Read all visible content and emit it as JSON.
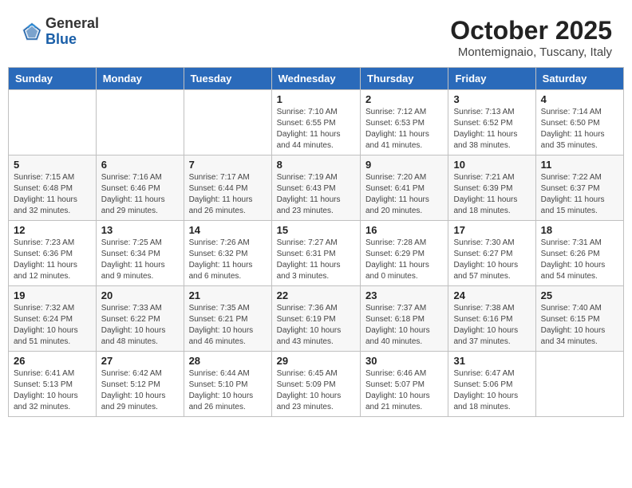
{
  "header": {
    "logo_general": "General",
    "logo_blue": "Blue",
    "month_title": "October 2025",
    "location": "Montemignaio, Tuscany, Italy"
  },
  "days_of_week": [
    "Sunday",
    "Monday",
    "Tuesday",
    "Wednesday",
    "Thursday",
    "Friday",
    "Saturday"
  ],
  "weeks": [
    [
      {
        "day": "",
        "info": ""
      },
      {
        "day": "",
        "info": ""
      },
      {
        "day": "",
        "info": ""
      },
      {
        "day": "1",
        "info": "Sunrise: 7:10 AM\nSunset: 6:55 PM\nDaylight: 11 hours and 44 minutes."
      },
      {
        "day": "2",
        "info": "Sunrise: 7:12 AM\nSunset: 6:53 PM\nDaylight: 11 hours and 41 minutes."
      },
      {
        "day": "3",
        "info": "Sunrise: 7:13 AM\nSunset: 6:52 PM\nDaylight: 11 hours and 38 minutes."
      },
      {
        "day": "4",
        "info": "Sunrise: 7:14 AM\nSunset: 6:50 PM\nDaylight: 11 hours and 35 minutes."
      }
    ],
    [
      {
        "day": "5",
        "info": "Sunrise: 7:15 AM\nSunset: 6:48 PM\nDaylight: 11 hours and 32 minutes."
      },
      {
        "day": "6",
        "info": "Sunrise: 7:16 AM\nSunset: 6:46 PM\nDaylight: 11 hours and 29 minutes."
      },
      {
        "day": "7",
        "info": "Sunrise: 7:17 AM\nSunset: 6:44 PM\nDaylight: 11 hours and 26 minutes."
      },
      {
        "day": "8",
        "info": "Sunrise: 7:19 AM\nSunset: 6:43 PM\nDaylight: 11 hours and 23 minutes."
      },
      {
        "day": "9",
        "info": "Sunrise: 7:20 AM\nSunset: 6:41 PM\nDaylight: 11 hours and 20 minutes."
      },
      {
        "day": "10",
        "info": "Sunrise: 7:21 AM\nSunset: 6:39 PM\nDaylight: 11 hours and 18 minutes."
      },
      {
        "day": "11",
        "info": "Sunrise: 7:22 AM\nSunset: 6:37 PM\nDaylight: 11 hours and 15 minutes."
      }
    ],
    [
      {
        "day": "12",
        "info": "Sunrise: 7:23 AM\nSunset: 6:36 PM\nDaylight: 11 hours and 12 minutes."
      },
      {
        "day": "13",
        "info": "Sunrise: 7:25 AM\nSunset: 6:34 PM\nDaylight: 11 hours and 9 minutes."
      },
      {
        "day": "14",
        "info": "Sunrise: 7:26 AM\nSunset: 6:32 PM\nDaylight: 11 hours and 6 minutes."
      },
      {
        "day": "15",
        "info": "Sunrise: 7:27 AM\nSunset: 6:31 PM\nDaylight: 11 hours and 3 minutes."
      },
      {
        "day": "16",
        "info": "Sunrise: 7:28 AM\nSunset: 6:29 PM\nDaylight: 11 hours and 0 minutes."
      },
      {
        "day": "17",
        "info": "Sunrise: 7:30 AM\nSunset: 6:27 PM\nDaylight: 10 hours and 57 minutes."
      },
      {
        "day": "18",
        "info": "Sunrise: 7:31 AM\nSunset: 6:26 PM\nDaylight: 10 hours and 54 minutes."
      }
    ],
    [
      {
        "day": "19",
        "info": "Sunrise: 7:32 AM\nSunset: 6:24 PM\nDaylight: 10 hours and 51 minutes."
      },
      {
        "day": "20",
        "info": "Sunrise: 7:33 AM\nSunset: 6:22 PM\nDaylight: 10 hours and 48 minutes."
      },
      {
        "day": "21",
        "info": "Sunrise: 7:35 AM\nSunset: 6:21 PM\nDaylight: 10 hours and 46 minutes."
      },
      {
        "day": "22",
        "info": "Sunrise: 7:36 AM\nSunset: 6:19 PM\nDaylight: 10 hours and 43 minutes."
      },
      {
        "day": "23",
        "info": "Sunrise: 7:37 AM\nSunset: 6:18 PM\nDaylight: 10 hours and 40 minutes."
      },
      {
        "day": "24",
        "info": "Sunrise: 7:38 AM\nSunset: 6:16 PM\nDaylight: 10 hours and 37 minutes."
      },
      {
        "day": "25",
        "info": "Sunrise: 7:40 AM\nSunset: 6:15 PM\nDaylight: 10 hours and 34 minutes."
      }
    ],
    [
      {
        "day": "26",
        "info": "Sunrise: 6:41 AM\nSunset: 5:13 PM\nDaylight: 10 hours and 32 minutes."
      },
      {
        "day": "27",
        "info": "Sunrise: 6:42 AM\nSunset: 5:12 PM\nDaylight: 10 hours and 29 minutes."
      },
      {
        "day": "28",
        "info": "Sunrise: 6:44 AM\nSunset: 5:10 PM\nDaylight: 10 hours and 26 minutes."
      },
      {
        "day": "29",
        "info": "Sunrise: 6:45 AM\nSunset: 5:09 PM\nDaylight: 10 hours and 23 minutes."
      },
      {
        "day": "30",
        "info": "Sunrise: 6:46 AM\nSunset: 5:07 PM\nDaylight: 10 hours and 21 minutes."
      },
      {
        "day": "31",
        "info": "Sunrise: 6:47 AM\nSunset: 5:06 PM\nDaylight: 10 hours and 18 minutes."
      },
      {
        "day": "",
        "info": ""
      }
    ]
  ]
}
